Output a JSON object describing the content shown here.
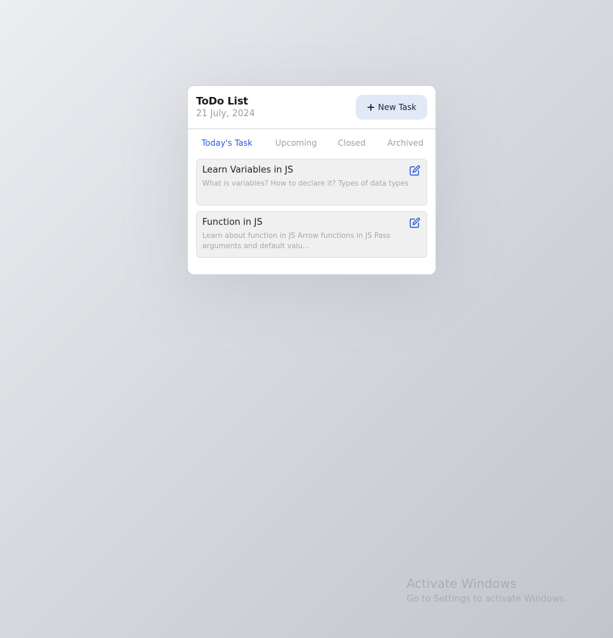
{
  "card": {
    "title": "ToDo List",
    "date": "21 July, 2024",
    "new_task_label": "New Task",
    "new_task_icon": "plus-icon"
  },
  "tabs": [
    {
      "label": "Today's Task",
      "active": true
    },
    {
      "label": "Upcoming",
      "active": false
    },
    {
      "label": "Closed",
      "active": false
    },
    {
      "label": "Archived",
      "active": false
    }
  ],
  "tasks": [
    {
      "title": "Learn Variables in JS",
      "description": "What is variables? How to declare it? Types of data types",
      "icon": "edit-icon"
    },
    {
      "title": "Function in JS",
      "description": "Learn about function in JS Arrow functions in JS Pass arguments and default valu...",
      "icon": "edit-icon"
    }
  ],
  "watermark": {
    "title": "Activate Windows",
    "subtitle": "Go to Settings to activate Windows."
  },
  "colors": {
    "accent": "#2a5bd7",
    "button_bg": "#e1e9f6",
    "task_bg": "#f0f0f0",
    "muted_text": "#9a9ea6"
  }
}
